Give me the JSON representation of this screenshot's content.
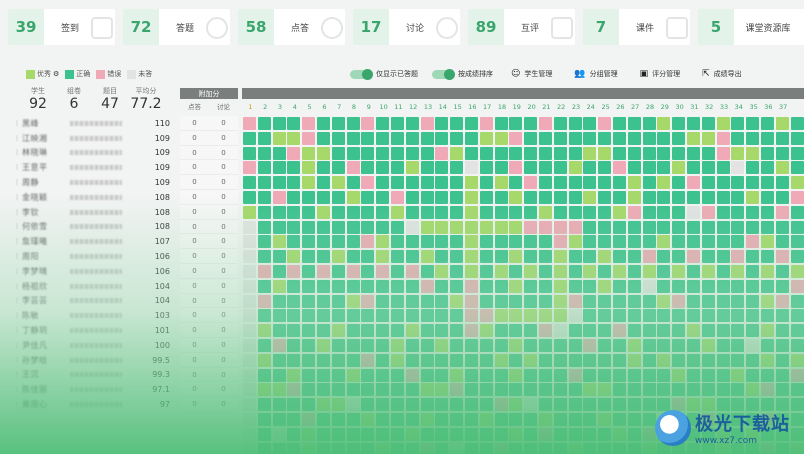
{
  "stats": [
    {
      "value": "39",
      "label": "签到",
      "icon": "calendar-check-icon"
    },
    {
      "value": "72",
      "label": "答题",
      "icon": "person-raise-hand-icon"
    },
    {
      "value": "58",
      "label": "点答",
      "icon": "check-circle-icon"
    },
    {
      "value": "17",
      "label": "讨论",
      "icon": "lightbulb-icon"
    },
    {
      "value": "89",
      "label": "互评",
      "icon": "bar-chart-icon"
    },
    {
      "value": "7",
      "label": "课件",
      "icon": "play-video-icon"
    },
    {
      "value": "5",
      "label": "课堂资源库",
      "icon": "folder-icon"
    }
  ],
  "legend": [
    {
      "label": "优秀",
      "color": "#a6d86a"
    },
    {
      "label": "正确",
      "color": "#3cc28f"
    },
    {
      "label": "错误",
      "color": "#f0a9b6"
    },
    {
      "label": "未答",
      "color": "#e3e3e3"
    }
  ],
  "summary": {
    "labels": [
      "学生",
      "组卷",
      "题目",
      "平均分"
    ],
    "values": [
      "92",
      "6",
      "47",
      "77.2"
    ]
  },
  "controls": {
    "show_answered": "仅显示已答题",
    "sort_by_score": "按成绩排序",
    "student_mgmt": "学生管理",
    "group_mgmt": "分组管理",
    "score_mgmt": "评分管理",
    "export": "成绩导出"
  },
  "bonus": {
    "title": "附加分",
    "col1": "点答",
    "col2": "讨论"
  },
  "students": [
    {
      "name": "黑峰",
      "score": "110"
    },
    {
      "name": "江映湘",
      "score": "109"
    },
    {
      "name": "林晓琳",
      "score": "109"
    },
    {
      "name": "王意平",
      "score": "109"
    },
    {
      "name": "周静",
      "score": "109"
    },
    {
      "name": "金晓颖",
      "score": "108"
    },
    {
      "name": "李钦",
      "score": "108"
    },
    {
      "name": "何依雪",
      "score": "108"
    },
    {
      "name": "詹瑾曦",
      "score": "107"
    },
    {
      "name": "周阳",
      "score": "106"
    },
    {
      "name": "李梦晴",
      "score": "106"
    },
    {
      "name": "杨祖欣",
      "score": "104"
    },
    {
      "name": "李芸芸",
      "score": "104"
    },
    {
      "name": "陈敏",
      "score": "103"
    },
    {
      "name": "丁静玥",
      "score": "101"
    },
    {
      "name": "尹佳凡",
      "score": "100"
    },
    {
      "name": "孙梦晗",
      "score": "99.5"
    },
    {
      "name": "王沉",
      "score": "99.3"
    },
    {
      "name": "陈佳丽",
      "score": "97.1"
    },
    {
      "name": "黄雨心",
      "score": "97"
    }
  ],
  "questions": [
    "1",
    "2",
    "3",
    "4",
    "5",
    "6",
    "7",
    "8",
    "9",
    "10",
    "11",
    "12",
    "13",
    "14",
    "15",
    "16",
    "17",
    "18",
    "19",
    "20",
    "21",
    "22",
    "23",
    "24",
    "25",
    "26",
    "27",
    "28",
    "29",
    "30",
    "31",
    "32",
    "33",
    "34",
    "35",
    "36",
    "37"
  ],
  "cell_colors": {
    "g": "#3cc28f",
    "y": "#a6d86a",
    "p": "#f0a9b6",
    "e": "#e3e3e3",
    "d": "#52b78a"
  },
  "watermark": {
    "title": "极光下载站",
    "url": "www.xz7.com"
  }
}
